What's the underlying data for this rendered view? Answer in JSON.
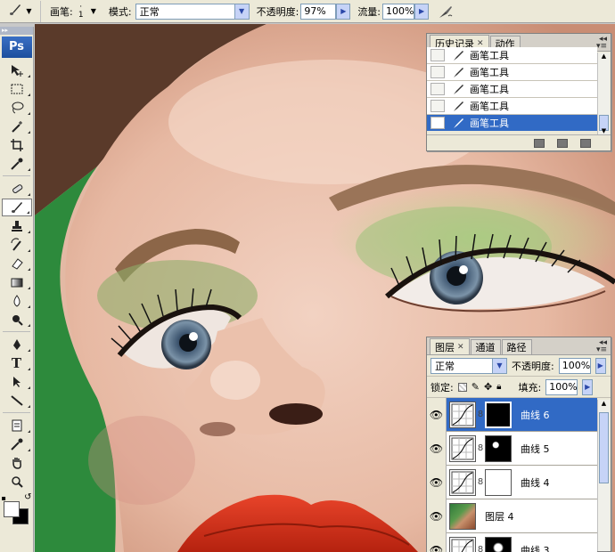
{
  "options_bar": {
    "brush_label": "画笔:",
    "brush_size": "1",
    "mode_label": "模式:",
    "mode_value": "正常",
    "opacity_label": "不透明度:",
    "opacity_value": "97%",
    "flow_label": "流量:",
    "flow_value": "100%"
  },
  "toolbox": {
    "logo": "Ps",
    "tools": [
      "move-icon",
      "marquee-icon",
      "lasso-icon",
      "magic-wand-icon",
      "crop-icon",
      "eyedropper-icon",
      "healing-brush-icon",
      "brush-icon",
      "clone-stamp-icon",
      "history-brush-icon",
      "eraser-icon",
      "gradient-icon",
      "blur-icon",
      "dodge-icon",
      "pen-icon",
      "type-icon",
      "path-selection-icon",
      "line-icon",
      "notes-icon",
      "eyedropper-2-icon",
      "hand-icon",
      "zoom-icon"
    ],
    "type_glyph": "T"
  },
  "history_panel": {
    "tabs": [
      "历史记录",
      "动作"
    ],
    "items": [
      "画笔工具",
      "画笔工具",
      "画笔工具",
      "画笔工具",
      "画笔工具"
    ],
    "selected_index": 4
  },
  "layers_panel": {
    "tabs": [
      "图层",
      "通道",
      "路径"
    ],
    "blend_mode": "正常",
    "opacity_label": "不透明度:",
    "opacity_value": "100%",
    "lock_label": "锁定:",
    "fill_label": "填充:",
    "fill_value": "100%",
    "layers": [
      {
        "name": "曲线 6",
        "selected": true
      },
      {
        "name": "曲线 5",
        "selected": false
      },
      {
        "name": "曲线 4",
        "selected": false
      },
      {
        "name": "图层 4",
        "selected": false
      },
      {
        "name": "曲线 3",
        "selected": false
      }
    ]
  },
  "colors": {
    "selection": "#316ac5",
    "panel_bg": "#ece9d8",
    "eyeshadow": "#8cb86a",
    "lips": "#d8301c",
    "backdrop": "#2d8a3c"
  }
}
